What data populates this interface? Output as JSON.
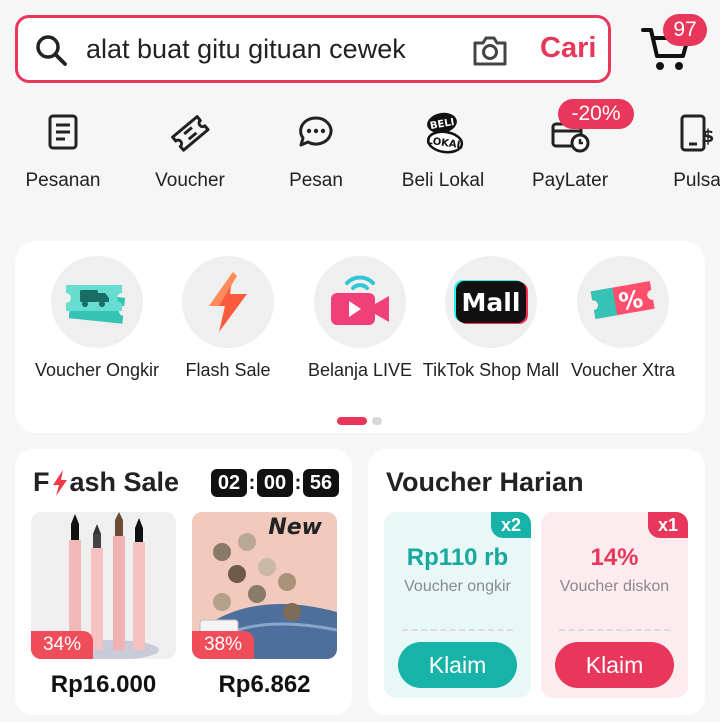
{
  "search": {
    "query": "alat buat gitu gituan cewek",
    "button_label": "Cari"
  },
  "cart": {
    "badge_count": "97"
  },
  "quick_menu": {
    "items": [
      {
        "label": "Pesanan",
        "icon": "orders-icon"
      },
      {
        "label": "Voucher",
        "icon": "voucher-ticket-icon"
      },
      {
        "label": "Pesan",
        "icon": "chat-bubble-icon"
      },
      {
        "label": "Beli Lokal",
        "icon": "beli-lokal-logo"
      },
      {
        "label": "PayLater",
        "icon": "paylater-clock-icon",
        "badge": "-20%"
      },
      {
        "label": "Pulsa",
        "icon": "phone-dollar-icon"
      }
    ]
  },
  "features": {
    "items": [
      {
        "label": "Voucher Ongkir",
        "icon": "shipping-voucher-icon"
      },
      {
        "label": "Flash Sale",
        "icon": "lightning-icon"
      },
      {
        "label": "Belanja LIVE",
        "icon": "live-camera-icon"
      },
      {
        "label": "TikTok Shop Mall",
        "icon": "mall-badge",
        "badge_text": "Mall"
      },
      {
        "label": "Voucher Xtra",
        "icon": "percent-voucher-icon",
        "badge_text": "%"
      }
    ],
    "pagination": {
      "pages": 2,
      "active": 1
    }
  },
  "flash_sale": {
    "title_prefix": "F",
    "title_suffix": "ash Sale",
    "timer": {
      "hours": "02",
      "minutes": "00",
      "seconds": "56"
    },
    "products": [
      {
        "discount": "34%",
        "price": "Rp16.000",
        "image": "eyeliner-pens"
      },
      {
        "discount": "38%",
        "price": "Rp6.862",
        "image": "jeans-buttons",
        "image_text": "New"
      }
    ]
  },
  "voucher_harian": {
    "title": "Voucher Harian",
    "vouchers": [
      {
        "multiplier": "x2",
        "amount": "Rp110 rb",
        "description": "Voucher ongkir",
        "button": "Klaim"
      },
      {
        "multiplier": "x1",
        "amount": "14%",
        "description": "Voucher diskon",
        "button": "Klaim"
      }
    ]
  },
  "colors": {
    "brand": "#e8375a",
    "teal": "#17b3a8",
    "background": "#f6f6f6"
  }
}
